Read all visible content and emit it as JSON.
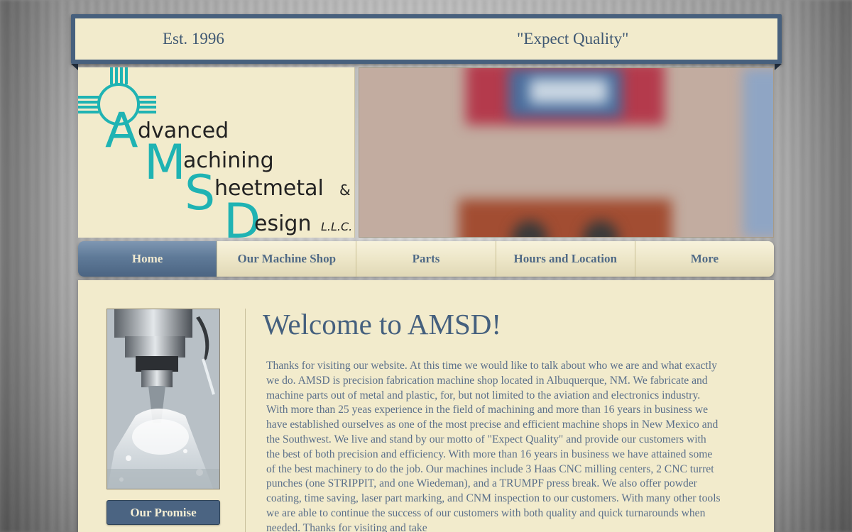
{
  "banner": {
    "left_text": "Est. 1996",
    "right_text": "\"Expect Quality\""
  },
  "logo": {
    "line1": "Advanced",
    "line2": "Machining",
    "line3": "Sheetmetal",
    "amp": "&",
    "line4": "Design",
    "suffix": "L.L.C.",
    "color": "#1fb3b3"
  },
  "nav": {
    "items": [
      {
        "label": "Home",
        "active": true
      },
      {
        "label": "Our Machine Shop",
        "active": false
      },
      {
        "label": "Parts",
        "active": false
      },
      {
        "label": "Hours and Location",
        "active": false
      },
      {
        "label": "More",
        "active": false
      }
    ]
  },
  "sidebar": {
    "promise_button": "Our Promise"
  },
  "main": {
    "heading": "Welcome to AMSD!",
    "body": "Thanks for visiting our website. At this time we would like to talk about who we are and what exactly we do.  AMSD is precision fabrication machine shop located in Albuquerque, NM.  We fabricate and machine parts out of metal and plastic, for, but not limited to the  aviation and electronics industry. With more than 25 yeas experience in the field of machining and more than 16 years in business we have established ourselves as one of the most precise and efficient machine shops in New Mexico and the Southwest. We live and stand by our motto of \"Expect Quality\" and provide our customers with the best of both precision and efficiency. With more than 16 years in business we have attained some of the best machinery to do the job.  Our machines include 3 Haas CNC milling centers, 2 CNC turret punches (one STRIPPIT, and one Wiedeman),  and a TRUMPF press break. We also offer powder coating, time saving, laser part marking, and CNM inspection to our customers. With many other tools we are able to continue the success of our customers with both quality and quick turnarounds when needed.  Thanks for visiting and take"
  },
  "colors": {
    "banner_frame": "#47607d",
    "cream": "#f2ebcc",
    "nav_active": "#5f7a98",
    "heading": "#45607e"
  }
}
